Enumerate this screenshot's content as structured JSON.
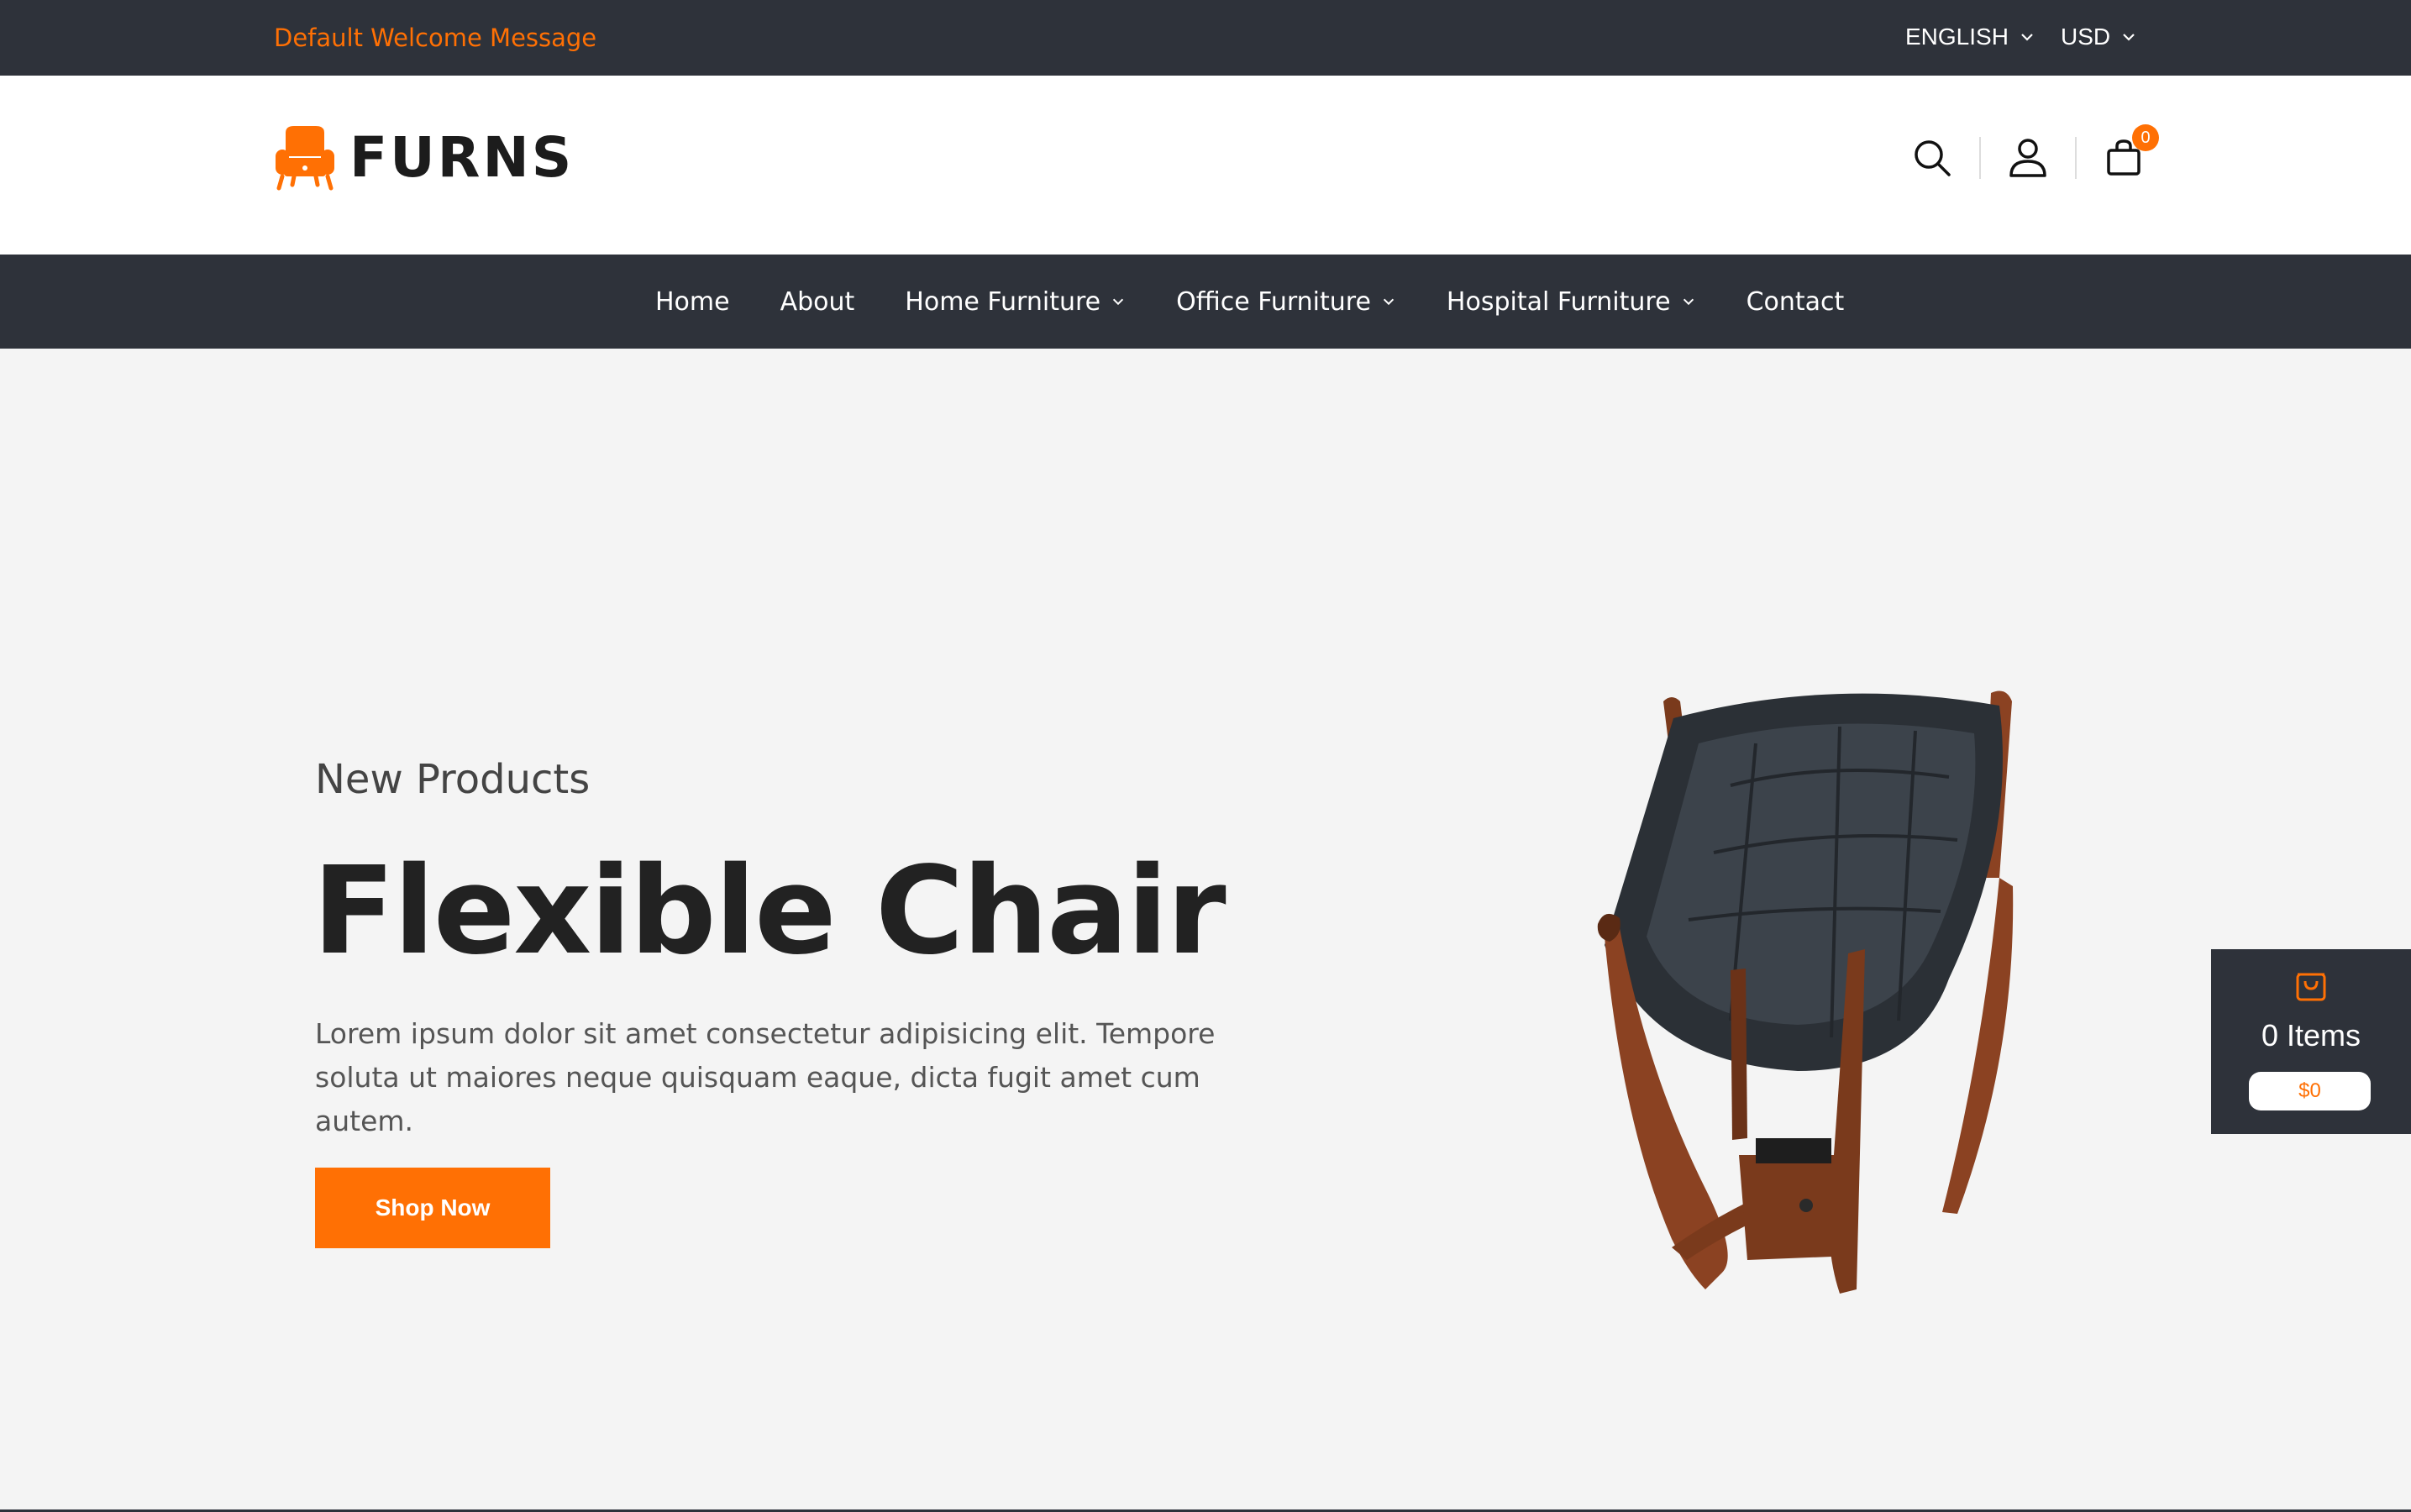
{
  "topbar": {
    "welcome": "Default Welcome Message",
    "language": "ENGLISH",
    "currency": "USD"
  },
  "header": {
    "logo_text": "FURNS",
    "cart_count": "0"
  },
  "nav": {
    "items": [
      {
        "label": "Home",
        "has_dropdown": false
      },
      {
        "label": "About",
        "has_dropdown": false
      },
      {
        "label": "Home Furniture",
        "has_dropdown": true
      },
      {
        "label": "Office Furniture",
        "has_dropdown": true
      },
      {
        "label": "Hospital Furniture",
        "has_dropdown": true
      },
      {
        "label": "Contact",
        "has_dropdown": false
      }
    ]
  },
  "hero": {
    "subtitle": "New Products",
    "title": "Flexible Chair",
    "description": "Lorem ipsum dolor sit amet consectetur adipisicing elit. Tempore soluta ut maiores neque quisquam eaque, dicta fugit amet cum autem.",
    "button_label": "Shop Now"
  },
  "float_cart": {
    "items": "0 Items",
    "total": "$0"
  },
  "colors": {
    "accent": "#ff7004",
    "dark": "#2e323a",
    "hero_bg": "#f4f4f4"
  }
}
